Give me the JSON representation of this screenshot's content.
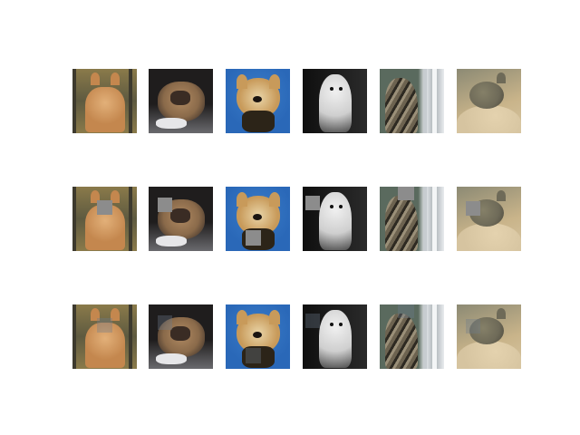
{
  "figure": {
    "rows": 3,
    "cols": 6,
    "subjects": [
      {
        "name": "orange-cat",
        "colors": {
          "bg": "#8a7a4a",
          "bg2": "#5e5a40",
          "body": "#c4874e",
          "accent": "#e2b079",
          "dark": "#3d3a2e"
        }
      },
      {
        "name": "bulldog",
        "colors": {
          "bg": "#1f1d1d",
          "bg2": "#6a6a6e",
          "body": "#8a6a4a",
          "accent": "#e6e6e8",
          "dark": "#2a2220"
        }
      },
      {
        "name": "yorkie",
        "colors": {
          "bg": "#2a68b8",
          "bg2": "#3a7cc8",
          "body": "#c89a5a",
          "accent": "#e9d5a8",
          "dark": "#2c2418"
        }
      },
      {
        "name": "white-spitz",
        "colors": {
          "bg": "#0f0f0f",
          "bg2": "#2a2a2a",
          "body": "#cfcfcf",
          "accent": "#f0f0f0",
          "dark": "#4a4a4a"
        }
      },
      {
        "name": "tabby-window",
        "colors": {
          "bg": "#5a6a5e",
          "bg2": "#e9ecef",
          "body": "#6d6350",
          "accent": "#9a8f78",
          "dark": "#2e2a22"
        }
      },
      {
        "name": "sleeping-cat",
        "colors": {
          "bg": "#8c8a74",
          "bg2": "#c9b48a",
          "body": "#6e6a58",
          "accent": "#d6c4a0",
          "dark": "#4a463a"
        }
      }
    ],
    "occlusion_row": {
      "color": "#8c8c8c"
    },
    "recon_row": {
      "patch_tint": "#6e7a8c"
    }
  }
}
